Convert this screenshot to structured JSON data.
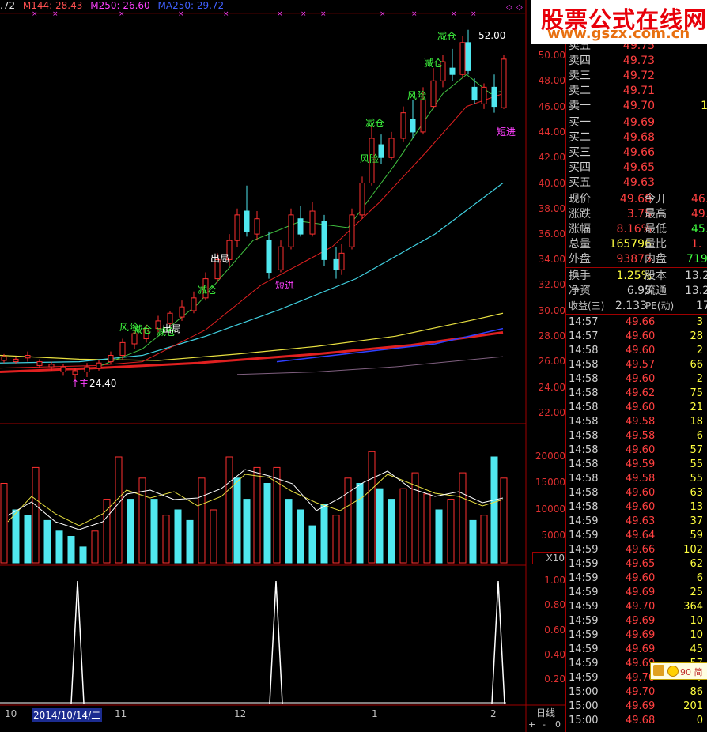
{
  "indicator_bar": {
    "first": ".72",
    "m144": "M144: 28.43",
    "m250": "M250: 26.60",
    "ma250": "MA250: 29.72"
  },
  "price_axis": [
    "50.00",
    "48.00",
    "46.00",
    "44.00",
    "42.00",
    "40.00",
    "38.00",
    "36.00",
    "34.00",
    "32.00",
    "30.00",
    "28.00",
    "26.00",
    "24.00",
    "22.00"
  ],
  "volume_axis": [
    "20000",
    "15000",
    "10000",
    "5000"
  ],
  "volume_unit": "X10",
  "signal_axis": [
    "1.00",
    "0.80",
    "0.60",
    "0.40",
    "0.20"
  ],
  "x_axis": [
    "10",
    "2014/10/14/二",
    "11",
    "12",
    "1",
    "2"
  ],
  "period_label": "日线",
  "high_marker": "52.00",
  "low_marker": "24.40",
  "annotations": {
    "jiancang1": "减仓",
    "jiancang2": "减仓",
    "jiancang3": "减仓",
    "jiancang4": "减仓",
    "jiancang5": "减仓",
    "jiancang6": "减仓",
    "fengxian1": "风险",
    "fengxian2": "风险",
    "fengxian3": "风险",
    "chuju1": "出局",
    "chuju2": "出局",
    "duanjin1": "短进",
    "duanjin2": "短进",
    "low_tag": "↑主"
  },
  "banner": {
    "title": "股票公式在线网",
    "url": "www.gszx.com.cn"
  },
  "order_book": {
    "sell": [
      {
        "label": "卖五",
        "price": "49.75",
        "vol": ""
      },
      {
        "label": "卖四",
        "price": "49.73",
        "vol": ""
      },
      {
        "label": "卖三",
        "price": "49.72",
        "vol": ""
      },
      {
        "label": "卖二",
        "price": "49.71",
        "vol": ""
      },
      {
        "label": "卖一",
        "price": "49.70",
        "vol": "1"
      }
    ],
    "buy": [
      {
        "label": "买一",
        "price": "49.69",
        "vol": ""
      },
      {
        "label": "买二",
        "price": "49.68",
        "vol": ""
      },
      {
        "label": "买三",
        "price": "49.66",
        "vol": ""
      },
      {
        "label": "买四",
        "price": "49.65",
        "vol": ""
      },
      {
        "label": "买五",
        "price": "49.63",
        "vol": ""
      }
    ]
  },
  "quote": {
    "xianjia_l": "现价",
    "xianjia": "49.68",
    "jinkai_l": "今开",
    "jinkai": "46.",
    "zhangdie_l": "涨跌",
    "zhangdie": "3.75",
    "zuigao_l": "最高",
    "zuigao": "49.",
    "zhangfu_l": "涨幅",
    "zhangfu": "8.16%",
    "zuidi_l": "最低",
    "zuidi": "45.",
    "zongliang_l": "总量",
    "zongliang": "165796",
    "liangbi_l": "量比",
    "liangbi": "1.",
    "waipan_l": "外盘",
    "waipan": "93873",
    "neipan_l": "内盘",
    "neipan": "719",
    "huanshou_l": "换手",
    "huanshou": "1.25%",
    "guben_l": "股本",
    "guben": "13.2",
    "jingzi_l": "净资",
    "jingzi": "6.95",
    "liutong_l": "流通",
    "liutong": "13.2",
    "shouyi_l": "收益(三)",
    "shouyi": "2.133",
    "pe_l": "PE(动)",
    "pe": "17"
  },
  "ticks": [
    {
      "t": "14:57",
      "p": "49.66",
      "v": "3"
    },
    {
      "t": "14:57",
      "p": "49.60",
      "v": "28"
    },
    {
      "t": "14:58",
      "p": "49.60",
      "v": "2"
    },
    {
      "t": "14:58",
      "p": "49.57",
      "v": "66"
    },
    {
      "t": "14:58",
      "p": "49.60",
      "v": "2"
    },
    {
      "t": "14:58",
      "p": "49.62",
      "v": "75"
    },
    {
      "t": "14:58",
      "p": "49.60",
      "v": "21"
    },
    {
      "t": "14:58",
      "p": "49.58",
      "v": "18"
    },
    {
      "t": "14:58",
      "p": "49.58",
      "v": "6"
    },
    {
      "t": "14:58",
      "p": "49.60",
      "v": "57"
    },
    {
      "t": "14:58",
      "p": "49.59",
      "v": "55"
    },
    {
      "t": "14:58",
      "p": "49.58",
      "v": "55"
    },
    {
      "t": "14:58",
      "p": "49.60",
      "v": "63"
    },
    {
      "t": "14:58",
      "p": "49.60",
      "v": "13"
    },
    {
      "t": "14:59",
      "p": "49.63",
      "v": "37"
    },
    {
      "t": "14:59",
      "p": "49.64",
      "v": "59"
    },
    {
      "t": "14:59",
      "p": "49.66",
      "v": "102"
    },
    {
      "t": "14:59",
      "p": "49.65",
      "v": "62"
    },
    {
      "t": "14:59",
      "p": "49.60",
      "v": "6"
    },
    {
      "t": "14:59",
      "p": "49.69",
      "v": "25"
    },
    {
      "t": "14:59",
      "p": "49.70",
      "v": "364"
    },
    {
      "t": "14:59",
      "p": "49.69",
      "v": "10"
    },
    {
      "t": "14:59",
      "p": "49.69",
      "v": "10"
    },
    {
      "t": "14:59",
      "p": "49.69",
      "v": "45"
    },
    {
      "t": "14:59",
      "p": "49.69",
      "v": "57"
    },
    {
      "t": "14:59",
      "p": "49.70",
      "v": "7"
    },
    {
      "t": "15:00",
      "p": "49.70",
      "v": "86"
    },
    {
      "t": "15:00",
      "p": "49.69",
      "v": "201"
    },
    {
      "t": "15:00",
      "p": "49.68",
      "v": "0"
    }
  ],
  "widget_text": "90 简",
  "controls": {
    "plus": "+",
    "minus": "-",
    "zero": "0"
  }
}
